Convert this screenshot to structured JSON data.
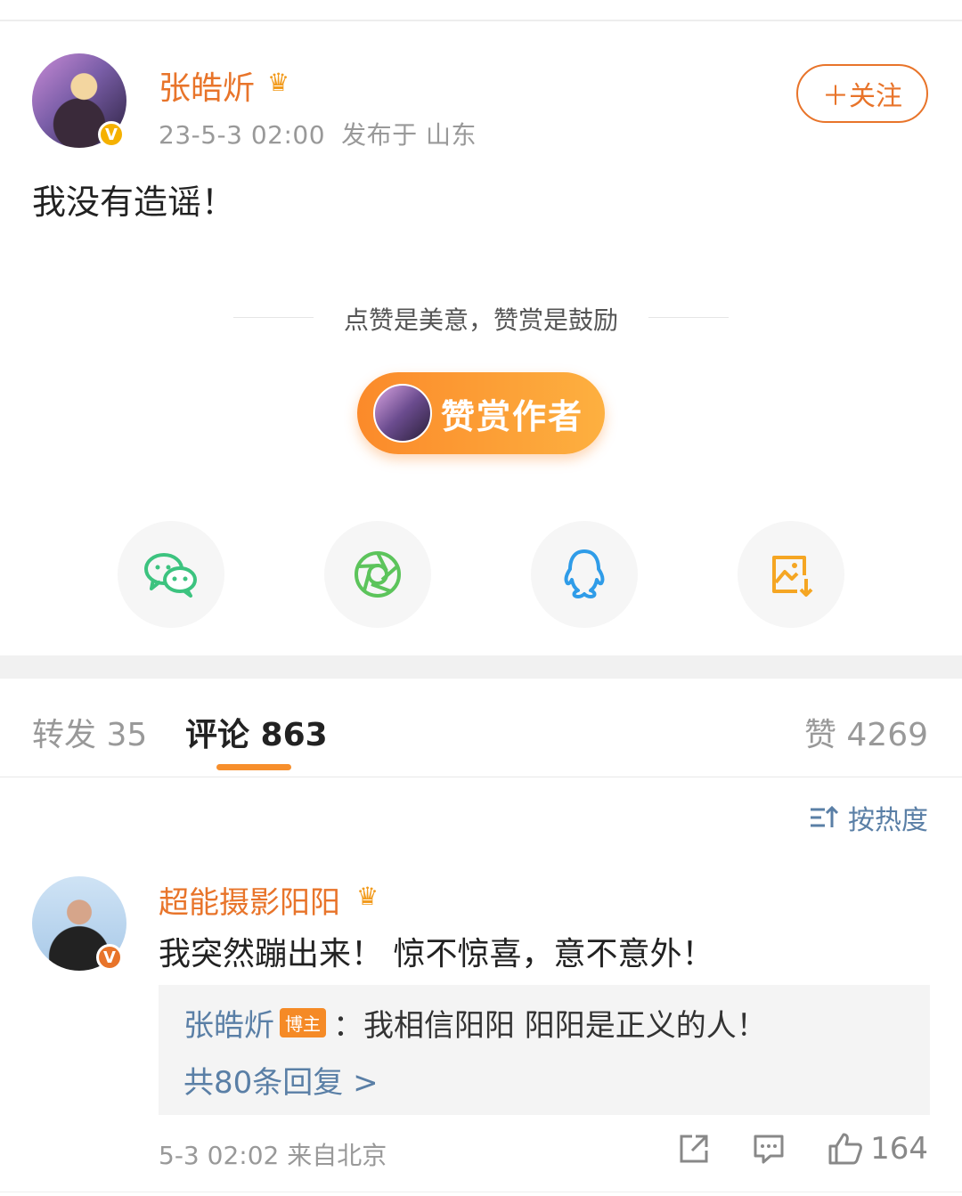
{
  "post": {
    "author": "张皓炘",
    "date": "23-5-3 02:00",
    "location": "发布于 山东",
    "follow_label": "＋关注",
    "text": "我没有造谣！"
  },
  "tip": {
    "caption": "点赞是美意，赞赏是鼓励",
    "button_label": "赞赏作者"
  },
  "share": {
    "items": [
      "wechat-icon",
      "moments-icon",
      "qq-icon",
      "save-image-icon"
    ],
    "colors": {
      "wechat": "#3cc37f",
      "moments": "#5cc45b",
      "qq": "#2f9ce8",
      "save": "#f5a623"
    }
  },
  "tabs": {
    "repost": "转发 35",
    "comment": "评论 863",
    "like": "赞 4269"
  },
  "sort_label": "按热度",
  "comment": {
    "user": "超能摄影阳阳",
    "text": "我突然蹦出来！ 惊不惊喜，意不意外！",
    "reply_user": "张皓炘",
    "reply_badge": "博主",
    "reply_text": "：我相信阳阳 阳阳是正义的人！",
    "reply_count": "共80条回复 >",
    "time_location": "5-3 02:02  来自北京",
    "like_count": "164"
  },
  "colors": {
    "accent": "#e8742a",
    "link": "#5a7fa6",
    "verified": "#f5b100"
  }
}
